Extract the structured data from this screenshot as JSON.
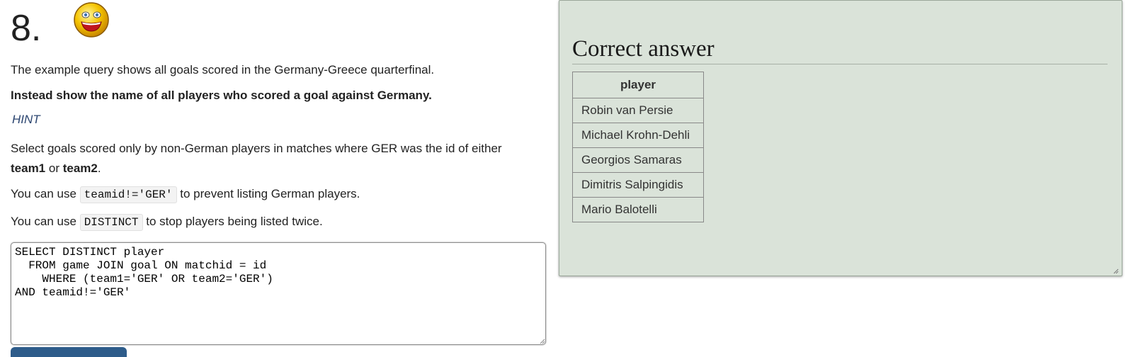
{
  "question": {
    "number": "8.",
    "intro": "The example query shows all goals scored in the Germany-Greece quarterfinal.",
    "task": "Instead show the name of all players who scored a goal against Germany.",
    "hint_label": "HINT",
    "hint_text_1": "Select goals scored only by non-German players in matches where GER was the id of either ",
    "hint_team1": "team1",
    "hint_or": " or ",
    "hint_team2": "team2",
    "hint_period": ".",
    "tip1_pre": "You can use ",
    "tip1_code": "teamid!='GER'",
    "tip1_post": " to prevent listing German players.",
    "tip2_pre": "You can use ",
    "tip2_code": "DISTINCT",
    "tip2_post": " to stop players being listed twice.",
    "smiley_icon": "smiley-face-icon"
  },
  "editor": {
    "sql": "SELECT DISTINCT player\n  FROM game JOIN goal ON matchid = id\n    WHERE (team1='GER' OR team2='GER')\nAND teamid!='GER'"
  },
  "answer": {
    "title": "Correct answer",
    "columns": [
      "player"
    ],
    "rows": [
      "Robin van Persie",
      "Michael Krohn-Dehli",
      "Georgios Samaras",
      "Dimitris Salpingidis",
      "Mario Balotelli"
    ]
  },
  "colors": {
    "answer_bg": "#dae3d9",
    "hint": "#2b4570",
    "run_button": "#2e5c8a"
  }
}
